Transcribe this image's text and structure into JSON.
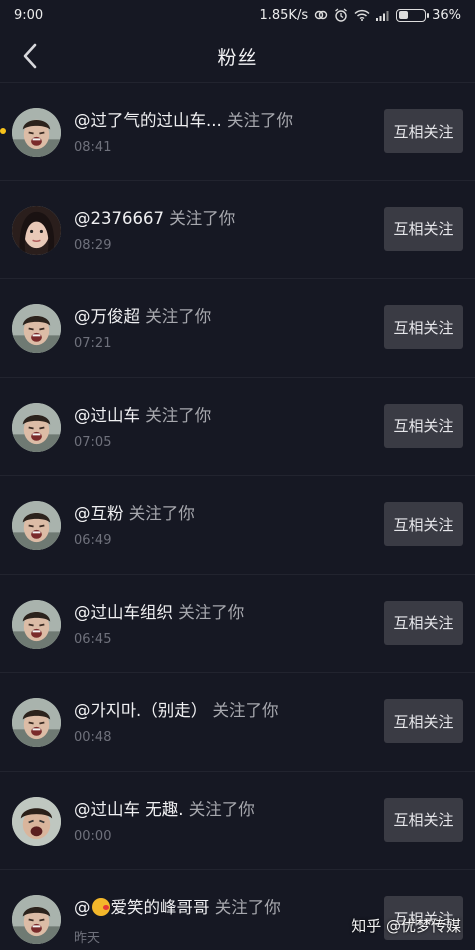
{
  "status_bar": {
    "time": "9:00",
    "net_speed": "1.85K/s",
    "battery": "36%",
    "battery_level": 0.36
  },
  "header": {
    "title": "粉丝"
  },
  "follow_button_label": "互相关注",
  "followers": [
    {
      "name": "@过了气的过山车...",
      "action": "关注了你",
      "time": "08:41",
      "unread": true
    },
    {
      "name": "@2376667",
      "action": "关注了你",
      "time": "08:29",
      "unread": false
    },
    {
      "name": "@万俊超",
      "action": "关注了你",
      "time": "07:21",
      "unread": false
    },
    {
      "name": "@过山车",
      "action": "关注了你",
      "time": "07:05",
      "unread": false
    },
    {
      "name": "@互粉",
      "action": "关注了你",
      "time": "06:49",
      "unread": false
    },
    {
      "name": "@过山车组织",
      "action": "关注了你",
      "time": "06:45",
      "unread": false
    },
    {
      "name": "@가지마.（别走）",
      "action": "关注了你",
      "time": "00:48",
      "unread": false
    },
    {
      "name": "@过山车 无趣.",
      "action": "关注了你",
      "time": "00:00",
      "unread": false
    },
    {
      "name_prefix": "@",
      "name_suffix": "爱笑的峰哥哥",
      "action": "关注了你",
      "time": "昨天",
      "unread": false,
      "emoji": "kiss-emoji"
    }
  ],
  "watermark": "知乎 @优梦传媒",
  "colors": {
    "background": "#161823",
    "button": "#3a3b44",
    "unread_dot": "#f7c21b"
  }
}
